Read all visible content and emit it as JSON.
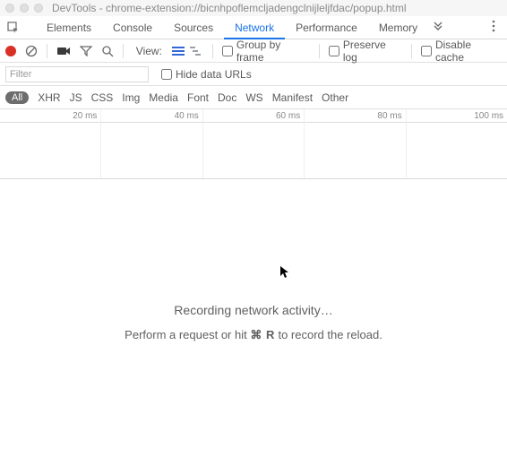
{
  "window": {
    "title": "DevTools - chrome-extension://bicnhpoflemcljadengclnijleljfdac/popup.html"
  },
  "tabs": {
    "elements": "Elements",
    "console": "Console",
    "sources": "Sources",
    "network": "Network",
    "performance": "Performance",
    "memory": "Memory"
  },
  "toolbar": {
    "view_label": "View:",
    "group_label": "Group by frame",
    "preserve_label": "Preserve log",
    "disable_cache_label": "Disable cache"
  },
  "filterbar": {
    "filter_placeholder": "Filter",
    "hide_data_label": "Hide data URLs"
  },
  "types": {
    "all": "All",
    "xhr": "XHR",
    "js": "JS",
    "css": "CSS",
    "img": "Img",
    "media": "Media",
    "font": "Font",
    "doc": "Doc",
    "ws": "WS",
    "manifest": "Manifest",
    "other": "Other"
  },
  "timeline": {
    "t20": "20 ms",
    "t40": "40 ms",
    "t60": "60 ms",
    "t80": "80 ms",
    "t100": "100 ms"
  },
  "content": {
    "recording": "Recording network activity…",
    "hint_prefix": "Perform a request or hit ",
    "hint_key": "⌘ R",
    "hint_suffix": " to record the reload."
  }
}
